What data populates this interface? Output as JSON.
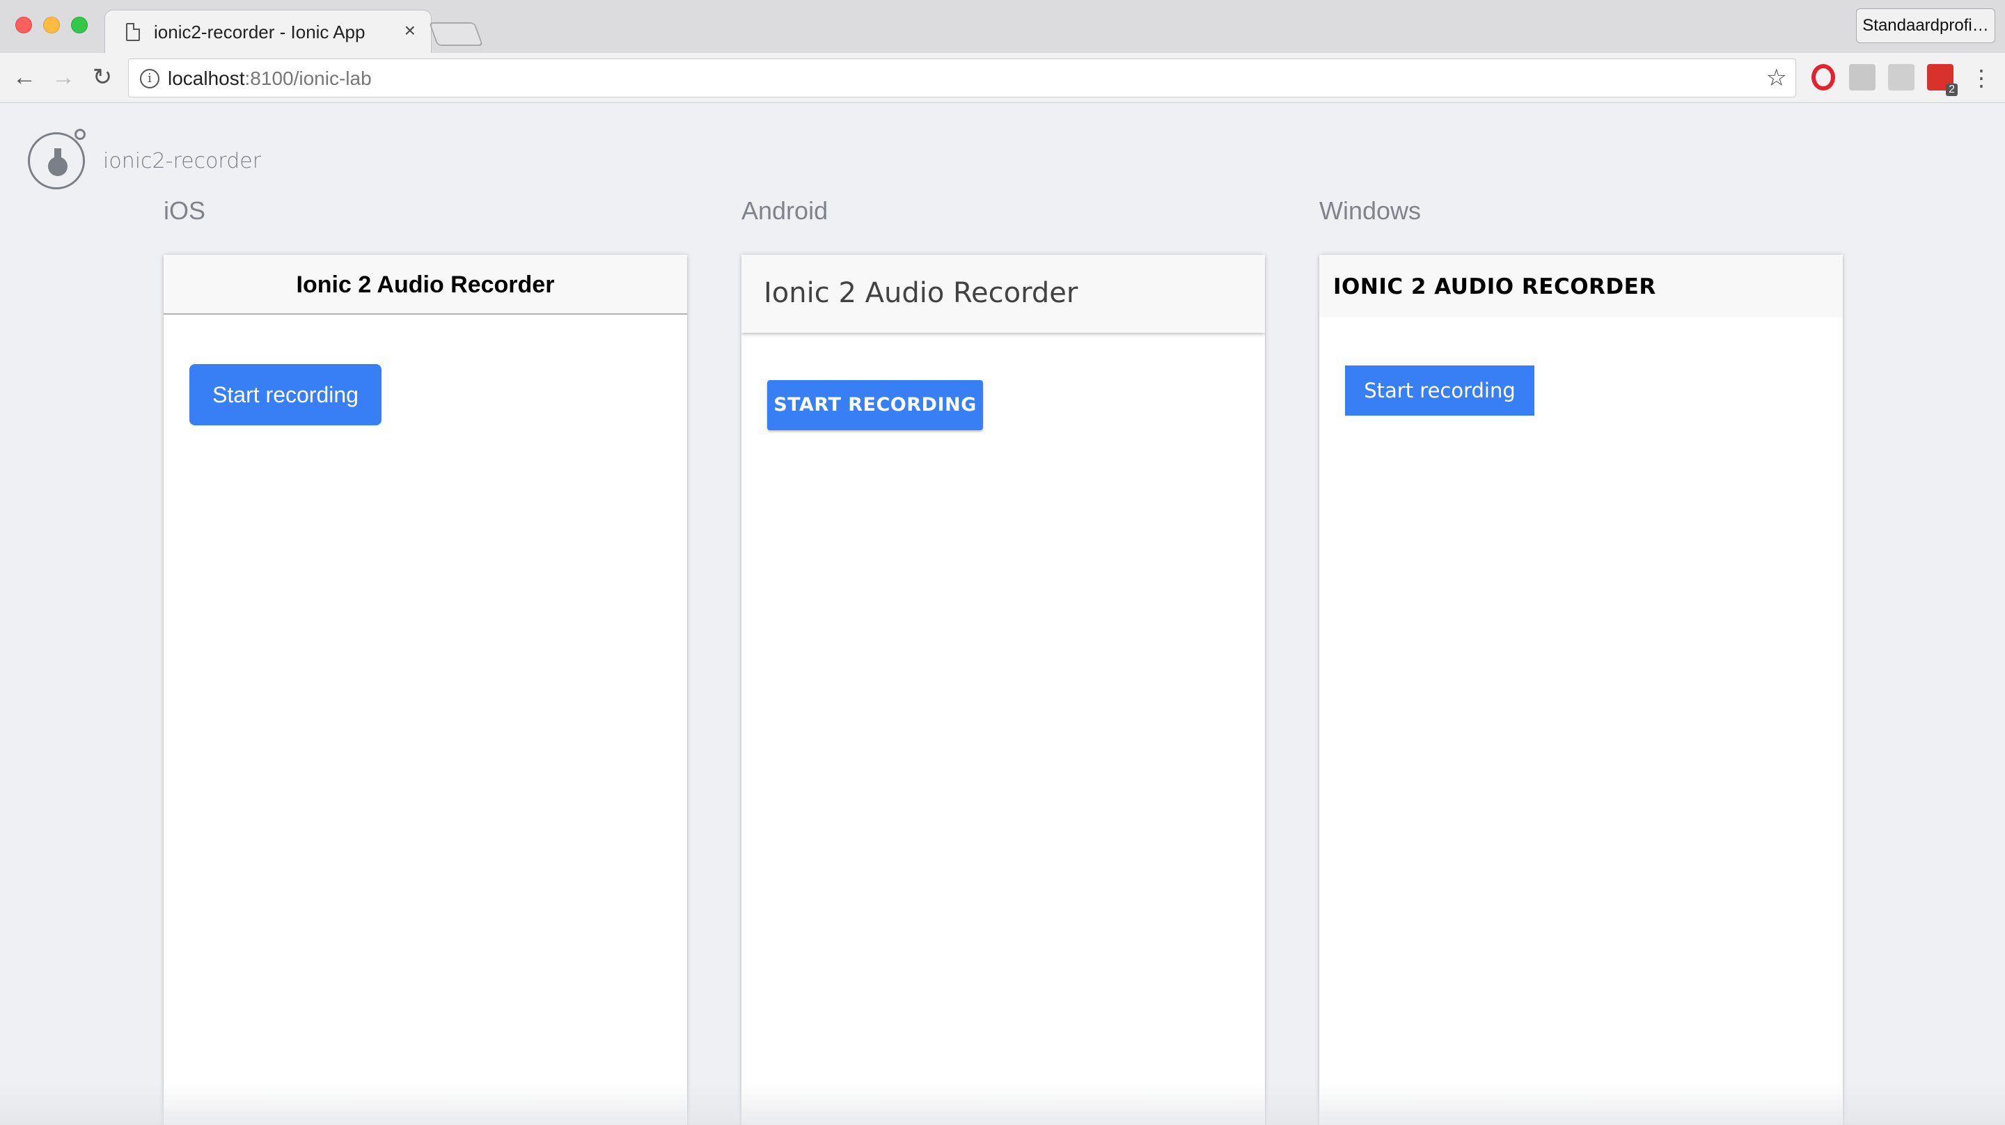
{
  "browser": {
    "tab_title": "ionic2-recorder - Ionic App",
    "tab_close": "×",
    "profile_label": "Standaardprofi…",
    "url_host": "localhost",
    "url_path": ":8100/ionic-lab",
    "ext_badge": "2",
    "icons": {
      "back": "←",
      "forward": "→",
      "reload": "↻",
      "info": "i",
      "star": "☆",
      "menu": "⋮"
    }
  },
  "lab": {
    "app_name": "ionic2-recorder",
    "platforms": {
      "ios": {
        "label": "iOS",
        "title": "Ionic 2 Audio Recorder",
        "button": "Start recording"
      },
      "android": {
        "label": "Android",
        "title": "Ionic 2 Audio Recorder",
        "button": "START RECORDING"
      },
      "windows": {
        "label": "Windows",
        "title": "IONIC 2 AUDIO RECORDER",
        "button": "Start recording"
      }
    }
  },
  "colors": {
    "primary": "#387ef5",
    "lab_background": "#eff0f4",
    "label_gray": "#7f848c"
  }
}
